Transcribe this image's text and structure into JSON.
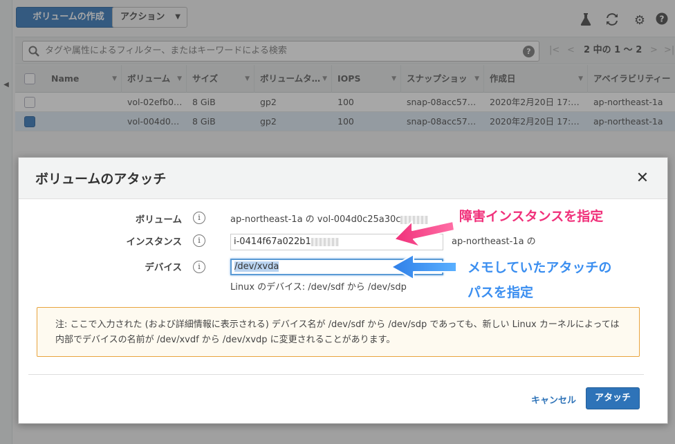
{
  "toolbar": {
    "create_volume": "ボリュームの作成",
    "actions": "アクション",
    "icons": [
      "flask-icon",
      "refresh-icon",
      "gear-icon",
      "help-icon"
    ]
  },
  "filter": {
    "placeholder": "タグや属性によるフィルター、またはキーワードによる検索",
    "pager_text": "2 中の 1 〜 2"
  },
  "table": {
    "columns": [
      "Name",
      "ボリューム",
      "サイズ",
      "ボリュームタ…",
      "IOPS",
      "スナップショッ",
      "作成日",
      "アベイラビリティー"
    ],
    "rows": [
      {
        "name": "",
        "volume": "vol-02efb0…",
        "size": "8 GiB",
        "type": "gp2",
        "iops": "100",
        "snapshot": "snap-08acc57…",
        "created": "2020年2月20日 17:…",
        "az": "ap-northeast-1a",
        "selected": false
      },
      {
        "name": "",
        "volume": "vol-004d0…",
        "size": "8 GiB",
        "type": "gp2",
        "iops": "100",
        "snapshot": "snap-08acc57…",
        "created": "2020年2月20日 17:…",
        "az": "ap-northeast-1a",
        "selected": true
      }
    ]
  },
  "modal": {
    "title": "ボリュームのアタッチ",
    "volume_label": "ボリューム",
    "volume_value": "ap-northeast-1a の vol-004d0c25a30c",
    "instance_label": "インスタンス",
    "instance_value": "i-0414f67a022b1",
    "instance_suffix": "ap-northeast-1a の",
    "device_label": "デバイス",
    "device_value": "/dev/xvda",
    "device_hint": "Linux のデバイス: /dev/sdf から /dev/sdp",
    "note": "注: ここで入力された (および詳細情報に表示される) デバイス名が /dev/sdf から /dev/sdp であっても、新しい Linux カーネルによっては内部でデバイスの名前が /dev/xvdf から /dev/xvdp に変更されることがあります。",
    "cancel": "キャンセル",
    "attach": "アタッチ"
  },
  "annotations": {
    "instance_note": "障害インスタンスを指定",
    "device_note_line1": "メモしていたアタッチの",
    "device_note_line2": "パスを指定",
    "instance_color": "#f0307a",
    "device_color": "#3a8ef0"
  }
}
